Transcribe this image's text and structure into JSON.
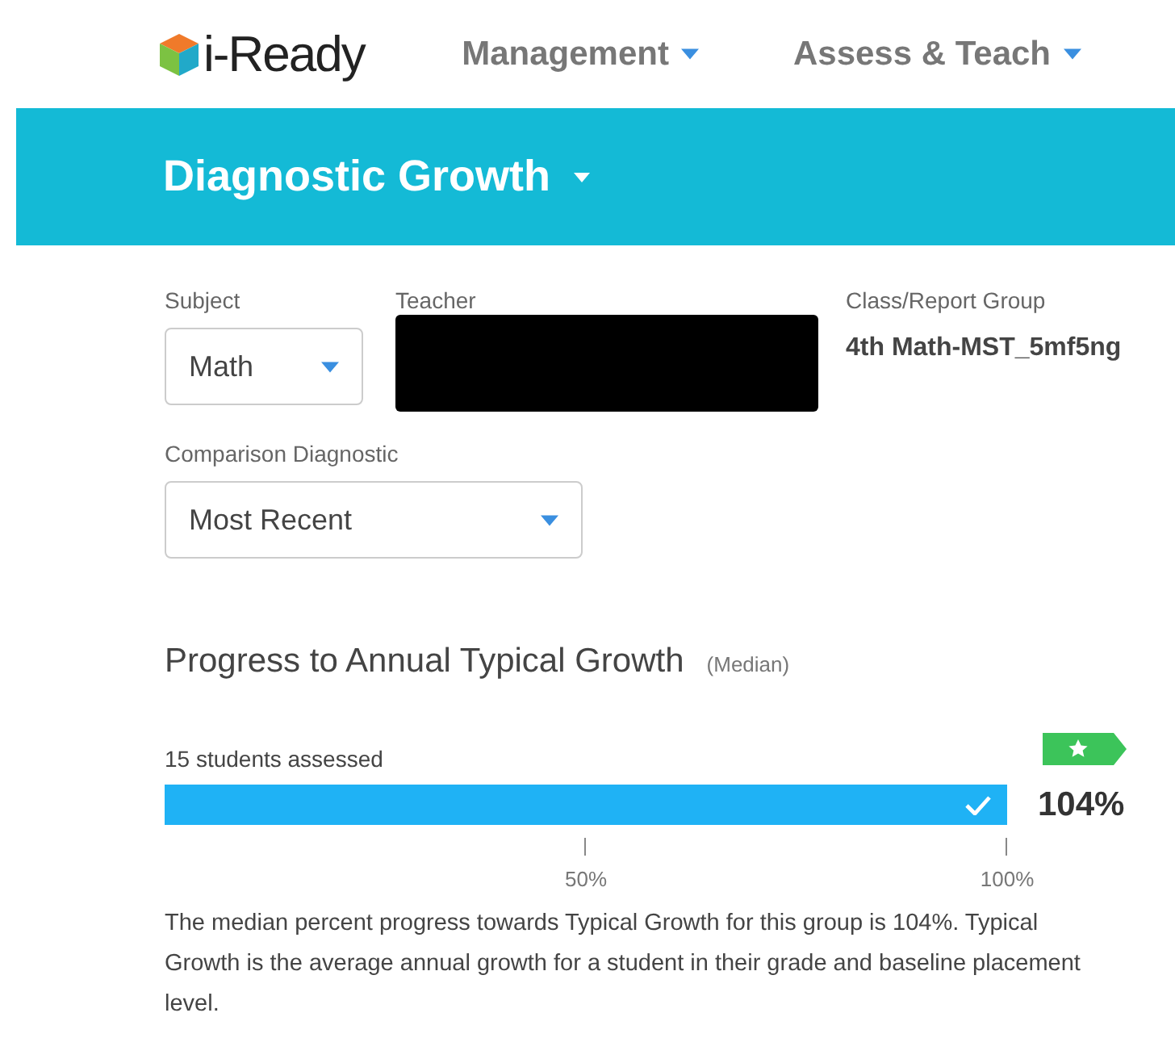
{
  "header": {
    "brand": "i-Ready",
    "nav": [
      {
        "label": "Management"
      },
      {
        "label": "Assess & Teach"
      }
    ]
  },
  "title_bar": {
    "title": "Diagnostic Growth"
  },
  "filters": {
    "subject": {
      "label": "Subject",
      "value": "Math"
    },
    "teacher": {
      "label": "Teacher"
    },
    "class_group": {
      "label": "Class/Report Group",
      "value": "4th Math-MST_5mf5ng"
    },
    "comparison": {
      "label": "Comparison Diagnostic",
      "value": "Most Recent"
    }
  },
  "progress": {
    "heading": "Progress to Annual Typical Growth",
    "qualifier": "(Median)",
    "assessed": "15 students assessed",
    "level": 1,
    "reading": "104%",
    "ticks": [
      "50%",
      "100%"
    ],
    "description": "The median percent progress towards Typical Growth for this group is 104%. Typical Growth is the average annual growth for a student in their grade and baseline placement level."
  }
}
